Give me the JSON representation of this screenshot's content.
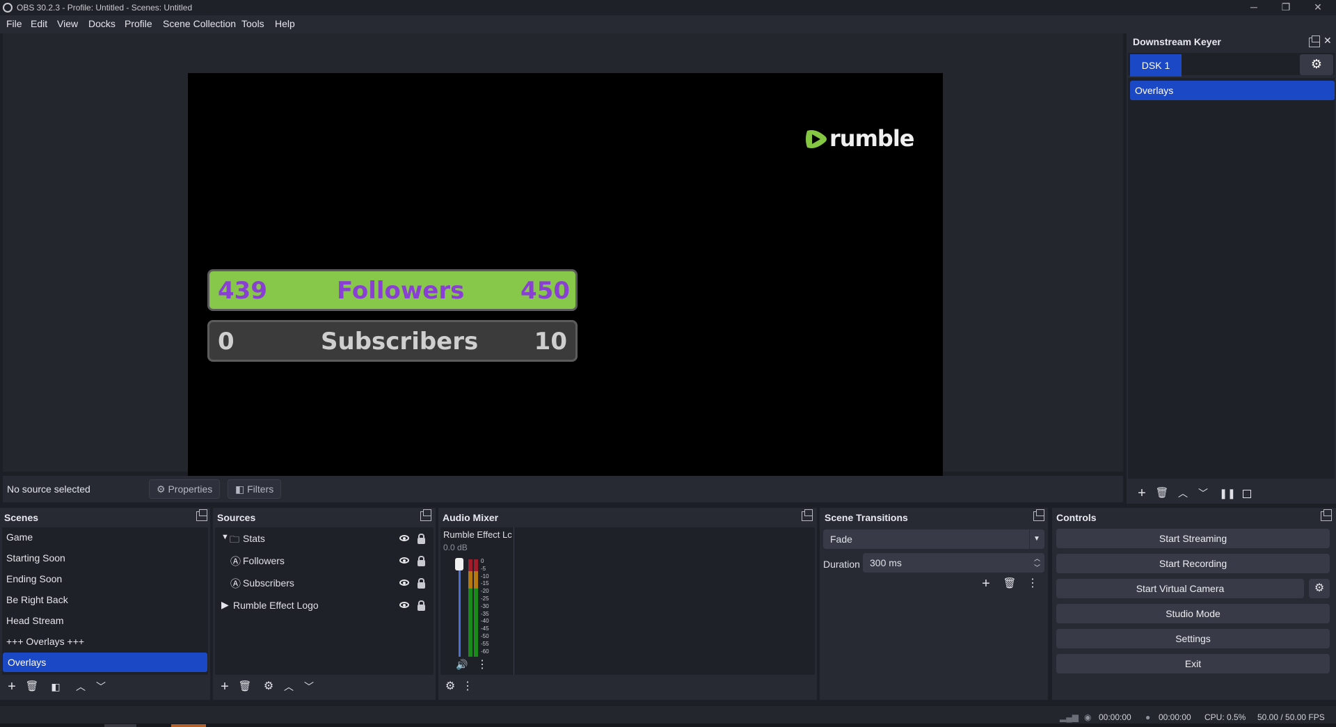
{
  "window": {
    "title": "OBS 30.2.3 - Profile: Untitled - Scenes: Untitled",
    "minimize": "─",
    "restore": "❐",
    "close": "✕"
  },
  "menu": [
    "File",
    "Edit",
    "View",
    "Docks",
    "Profile",
    "Scene Collection",
    "Tools",
    "Help"
  ],
  "preview": {
    "logo_text": "rumble",
    "followers": {
      "left": "439",
      "label": "Followers",
      "right": "450"
    },
    "subscribers": {
      "left": "0",
      "label": "Subscribers",
      "right": "10"
    },
    "colors": {
      "followers_bg": "#87c84a",
      "followers_text": "#8a3fd4",
      "subscribers_bg": "#3b3b3b",
      "logo_green": "#85c742"
    }
  },
  "source_bar": {
    "status": "No source selected",
    "properties_label": "Properties",
    "filters_label": "Filters"
  },
  "downstream_keyer": {
    "title": "Downstream Keyer",
    "tab": "DSK 1",
    "selected_scene": "Overlays"
  },
  "scenes": {
    "title": "Scenes",
    "items": [
      "Game",
      "Starting Soon",
      "Ending Soon",
      "Be Right Back",
      "Head Stream",
      "+++ Overlays +++",
      "Overlays"
    ],
    "selected": "Overlays"
  },
  "sources": {
    "title": "Sources",
    "items": [
      {
        "label": "Stats",
        "type": "group-expanded"
      },
      {
        "label": "Followers",
        "type": "text-child"
      },
      {
        "label": "Subscribers",
        "type": "text-child"
      },
      {
        "label": "Rumble Effect Logo",
        "type": "group-collapsed"
      }
    ]
  },
  "audio_mixer": {
    "title": "Audio Mixer",
    "channel_name": "Rumble Effect Lc",
    "channel_level": "0.0 dB",
    "scale": [
      "0",
      "-5",
      "-10",
      "-15",
      "-20",
      "-25",
      "-30",
      "-35",
      "-40",
      "-45",
      "-50",
      "-55",
      "-60"
    ]
  },
  "scene_transitions": {
    "title": "Scene Transitions",
    "transition": "Fade",
    "duration_label": "Duration",
    "duration_value": "300 ms"
  },
  "controls": {
    "title": "Controls",
    "start_streaming": "Start Streaming",
    "start_recording": "Start Recording",
    "start_virtual_camera": "Start Virtual Camera",
    "studio_mode": "Studio Mode",
    "settings": "Settings",
    "exit": "Exit"
  },
  "status": {
    "stream_time": "00:00:00",
    "record_time": "00:00:00",
    "cpu": "CPU: 0.5%",
    "fps": "50.00 / 50.00 FPS"
  }
}
